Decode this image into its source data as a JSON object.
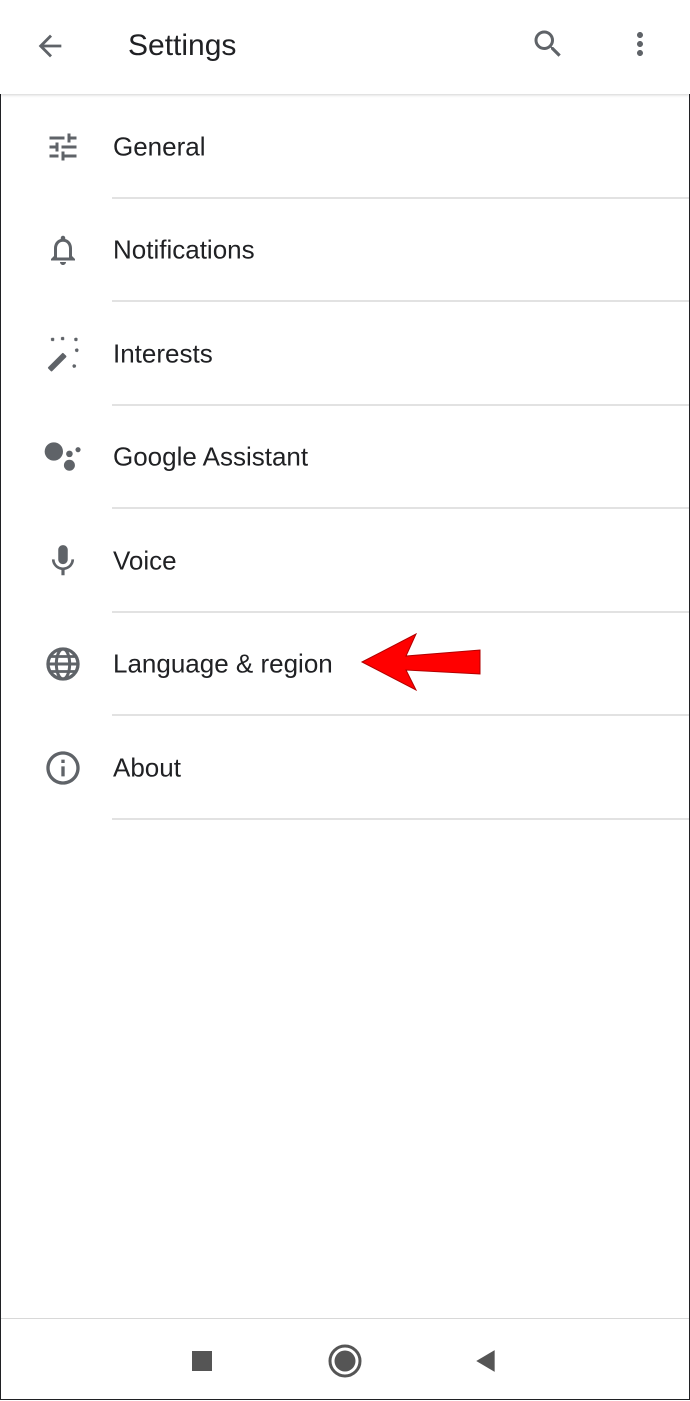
{
  "appbar": {
    "title": "Settings",
    "back_icon": "arrow-back-icon",
    "search_icon": "search-icon",
    "more_icon": "more-vert-icon"
  },
  "settings": {
    "items": [
      {
        "label": "General",
        "icon": "tune-icon"
      },
      {
        "label": "Notifications",
        "icon": "bell-icon"
      },
      {
        "label": "Interests",
        "icon": "magic-wand-icon"
      },
      {
        "label": "Google Assistant",
        "icon": "assistant-icon"
      },
      {
        "label": "Voice",
        "icon": "mic-icon"
      },
      {
        "label": "Language & region",
        "icon": "globe-icon"
      },
      {
        "label": "About",
        "icon": "info-icon"
      }
    ]
  },
  "annotation": {
    "arrow_color": "#ff0000",
    "points_to": "Language & region"
  },
  "navbar": {
    "recents_icon": "square-recents-icon",
    "home_icon": "circle-home-icon",
    "back_icon": "triangle-back-icon"
  },
  "colors": {
    "icon": "#5f6368",
    "text": "#202124",
    "divider": "#e2e2e2"
  }
}
